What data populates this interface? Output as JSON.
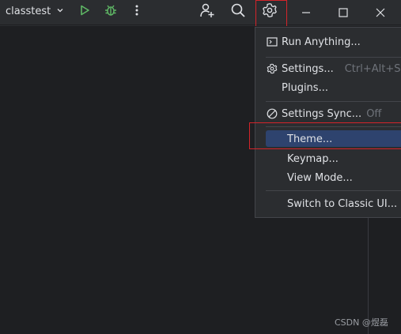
{
  "project": {
    "name": "classtest"
  },
  "icons": {
    "project_dropdown": "chevron-down-icon",
    "run": "run-play-icon",
    "debug": "debug-bug-icon",
    "more": "more-vertical-icon",
    "add_user": "add-user-icon",
    "search": "search-icon",
    "settings": "gear-icon",
    "minimize": "minimize-icon",
    "maximize": "maximize-icon",
    "close": "close-icon"
  },
  "colors": {
    "run": "#5fb865",
    "debug": "#5fb865",
    "highlight_bg": "#2e436e",
    "callout_border": "#d4242a"
  },
  "menu": {
    "run_anything": "Run Anything...",
    "settings": "Settings...",
    "settings_shortcut": "Ctrl+Alt+S",
    "plugins": "Plugins...",
    "settings_sync": "Settings Sync...",
    "settings_sync_state": "Off",
    "theme": "Theme...",
    "keymap": "Keymap...",
    "view_mode": "View Mode...",
    "switch_classic": "Switch to Classic UI..."
  },
  "watermark": "CSDN @煜磊"
}
